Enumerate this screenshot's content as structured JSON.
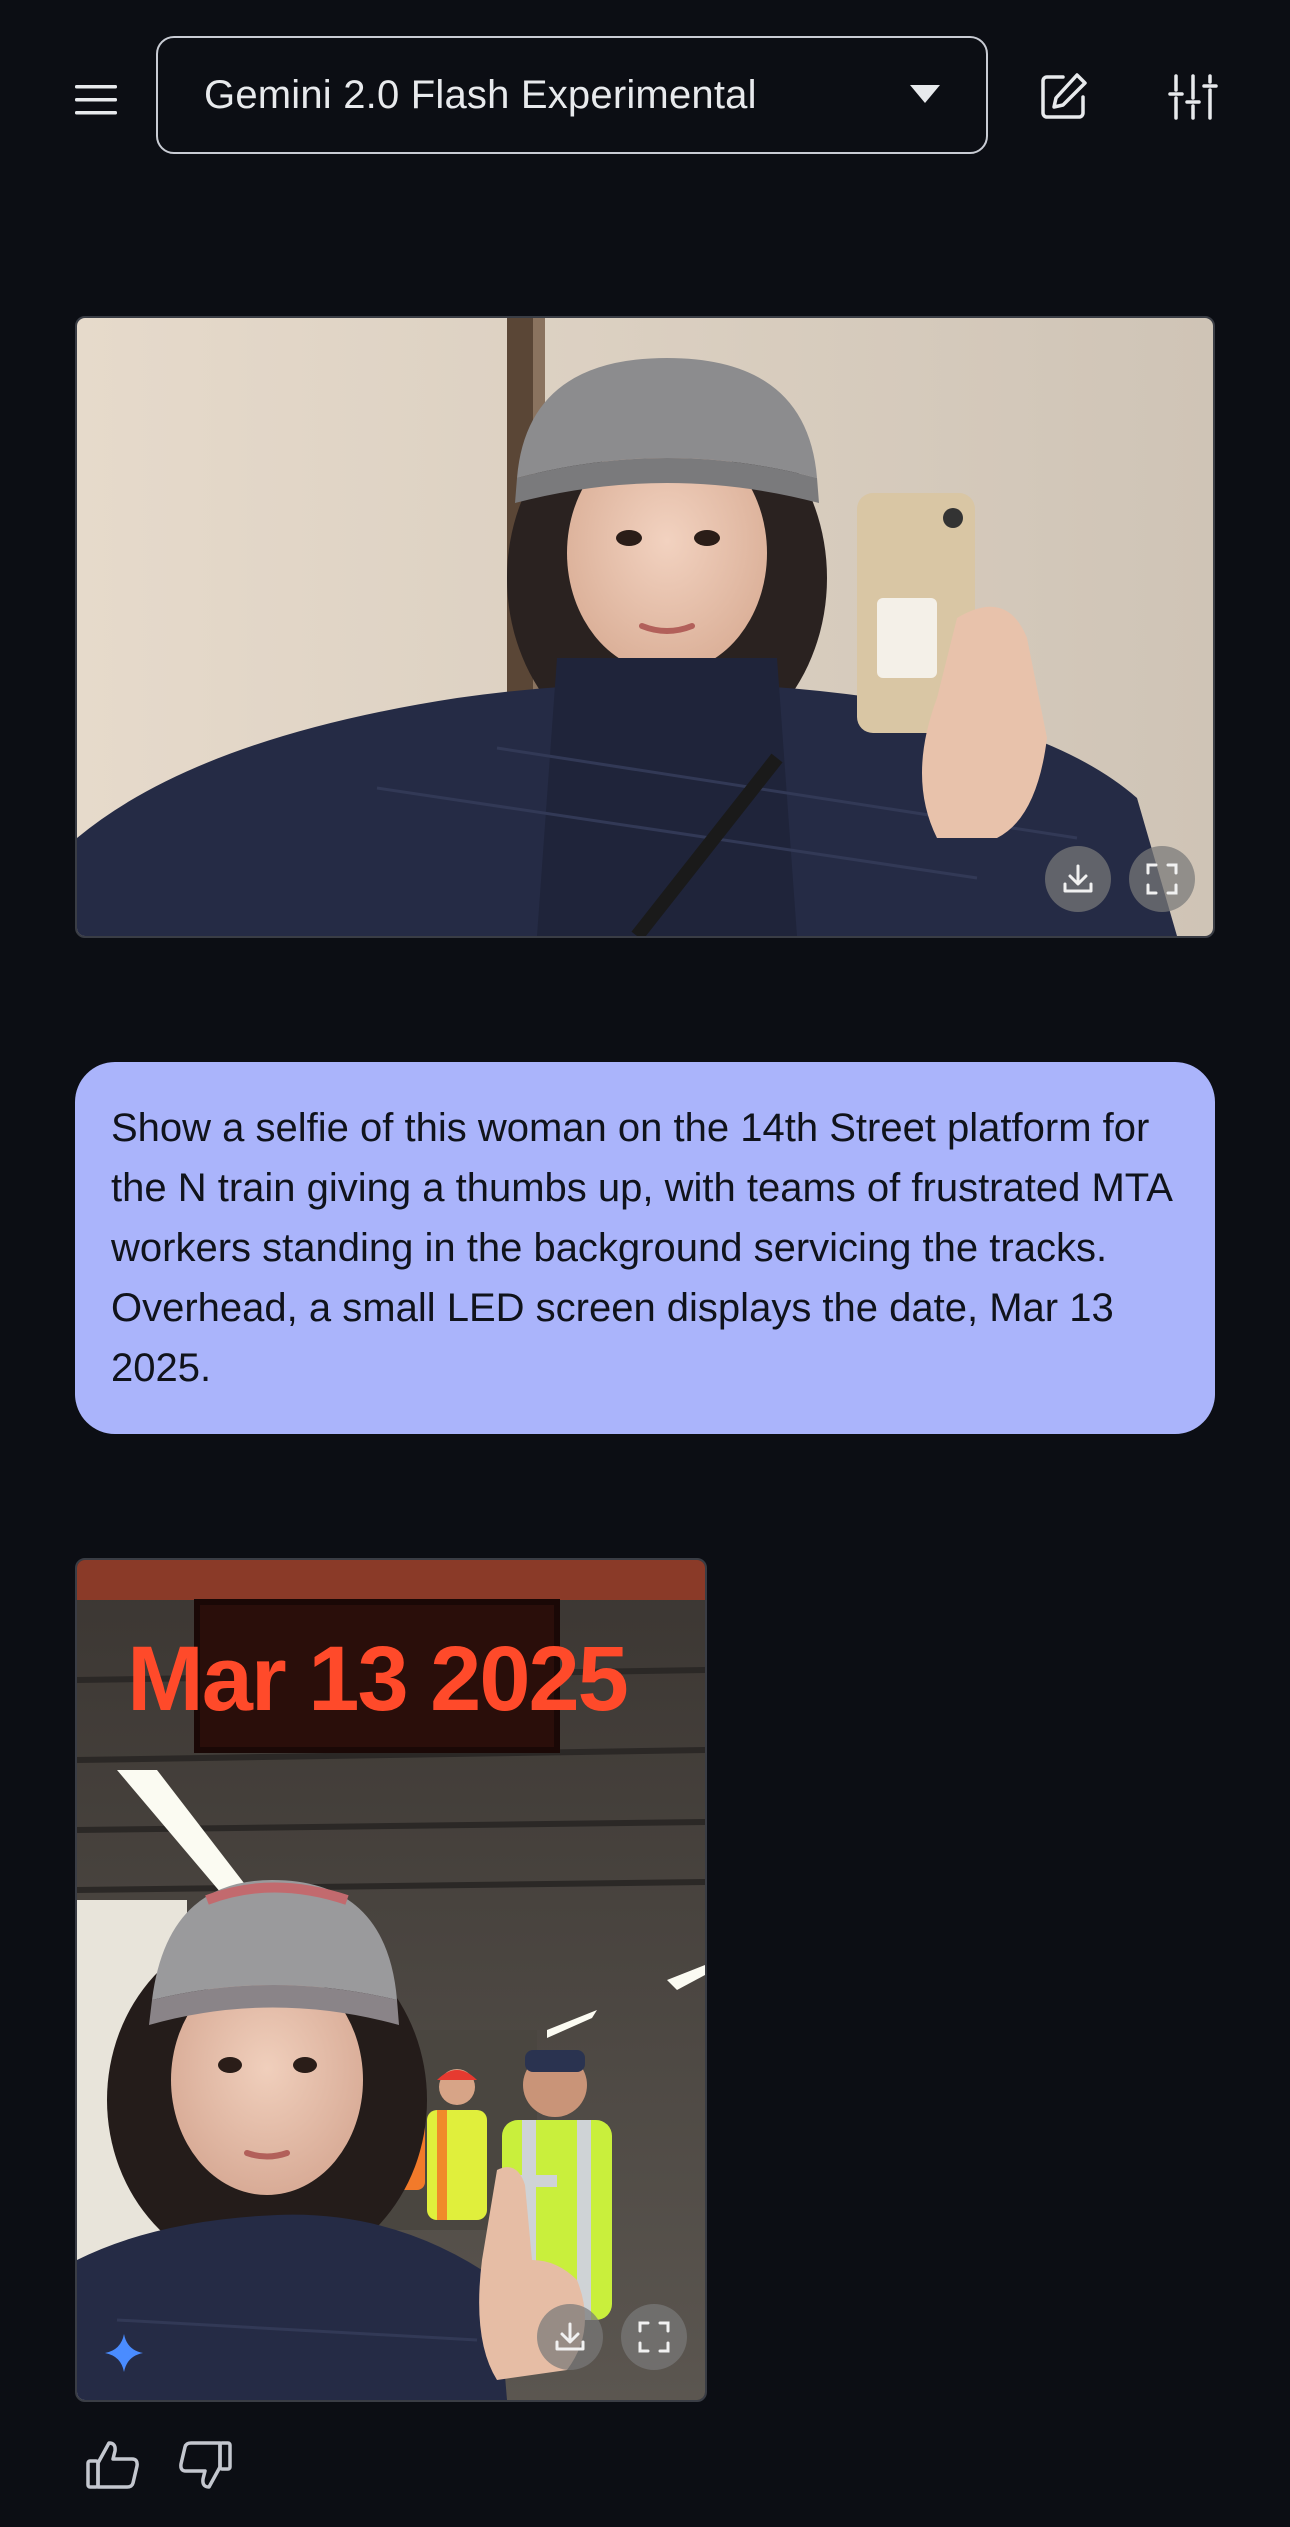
{
  "header": {
    "model_label": "Gemini 2.0 Flash Experimental",
    "icons": {
      "menu": "hamburger-menu-icon",
      "edit": "new-chat-edit-icon",
      "tune": "tune-settings-icon",
      "caret": "chevron-down-icon"
    }
  },
  "conversation": {
    "uploaded_image": {
      "led_text": "",
      "actions": [
        "download-icon",
        "fullscreen-icon"
      ]
    },
    "user_prompt": "Show a selfie of this woman on the 14th Street platform for the N train giving a thumbs up, with teams of frustrated MTA workers standing in the background servicing the tracks. Overhead, a small LED screen displays the date, Mar 13 2025.",
    "generated_image": {
      "led_text": "Mar 13 2025",
      "actions": [
        "download-icon",
        "fullscreen-icon"
      ],
      "badge_icon": "gemini-sparkle-icon"
    },
    "feedback_icons": [
      "thumbs-up-icon",
      "thumbs-down-icon"
    ]
  },
  "colors": {
    "background": "#0c0e14",
    "prompt_bubble": "#aab4fb",
    "led": "#ff4a2a",
    "sparkle": "#4a8cff"
  }
}
